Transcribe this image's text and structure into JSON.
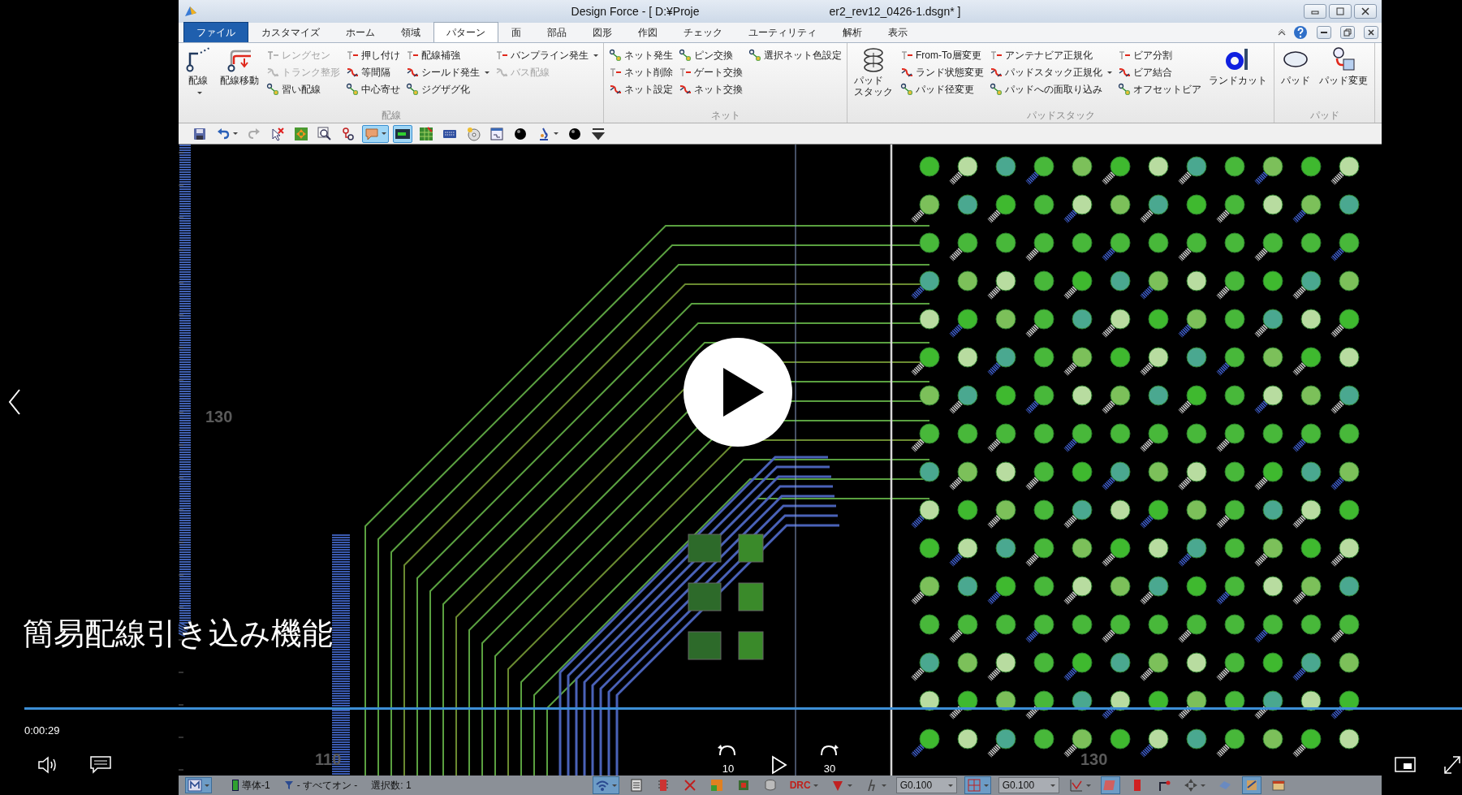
{
  "window": {
    "title_left": "Design Force - [ D:¥Proje",
    "title_right": "er2_rev12_0426-1.dsgn* ]"
  },
  "tabs": [
    {
      "label": "ファイル",
      "kind": "file",
      "selected": false
    },
    {
      "label": "カスタマイズ",
      "kind": "tab",
      "selected": false
    },
    {
      "label": "ホーム",
      "kind": "tab",
      "selected": false
    },
    {
      "label": "領域",
      "kind": "tab",
      "selected": false
    },
    {
      "label": "パターン",
      "kind": "tab",
      "selected": true
    },
    {
      "label": "面",
      "kind": "tab",
      "selected": false
    },
    {
      "label": "部品",
      "kind": "tab",
      "selected": false
    },
    {
      "label": "図形",
      "kind": "tab",
      "selected": false
    },
    {
      "label": "作図",
      "kind": "tab",
      "selected": false
    },
    {
      "label": "チェック",
      "kind": "tab",
      "selected": false
    },
    {
      "label": "ユーティリティ",
      "kind": "tab",
      "selected": false
    },
    {
      "label": "解析",
      "kind": "tab",
      "selected": false
    },
    {
      "label": "表示",
      "kind": "tab",
      "selected": false
    }
  ],
  "ribbon": {
    "groups": [
      {
        "label": "配線",
        "items": [
          {
            "kind": "large",
            "lines": [
              "配線"
            ],
            "dropdown": true
          },
          {
            "kind": "large",
            "lines": [
              "配線移動"
            ],
            "dropdown": false
          },
          {
            "kind": "column",
            "items": [
              {
                "label": "レングセン",
                "disabled": true,
                "dropdown": false
              },
              {
                "label": "トランク整形",
                "disabled": true,
                "dropdown": false
              },
              {
                "label": "習い配線",
                "disabled": false,
                "dropdown": false
              }
            ]
          },
          {
            "kind": "column",
            "items": [
              {
                "label": "押し付け",
                "disabled": false,
                "dropdown": false
              },
              {
                "label": "等間隔",
                "disabled": false,
                "dropdown": false
              },
              {
                "label": "中心寄せ",
                "disabled": false,
                "dropdown": false
              }
            ]
          },
          {
            "kind": "column",
            "items": [
              {
                "label": "配線補強",
                "disabled": false,
                "dropdown": false
              },
              {
                "label": "シールド発生",
                "disabled": false,
                "dropdown": true
              },
              {
                "label": "ジグザグ化",
                "disabled": false,
                "dropdown": false
              }
            ]
          },
          {
            "kind": "column",
            "items": [
              {
                "label": "バンプライン発生",
                "disabled": false,
                "dropdown": true
              },
              {
                "label": "バス配線",
                "disabled": true,
                "dropdown": false
              }
            ]
          }
        ]
      },
      {
        "label": "ネット",
        "items": [
          {
            "kind": "column",
            "items": [
              {
                "label": "ネット発生",
                "disabled": false,
                "dropdown": false
              },
              {
                "label": "ネット削除",
                "disabled": false,
                "dropdown": false
              },
              {
                "label": "ネット設定",
                "disabled": false,
                "dropdown": false
              }
            ]
          },
          {
            "kind": "column",
            "items": [
              {
                "label": "ピン交換",
                "disabled": false,
                "dropdown": false
              },
              {
                "label": "ゲート交換",
                "disabled": false,
                "dropdown": false
              },
              {
                "label": "ネット交換",
                "disabled": false,
                "dropdown": false
              }
            ]
          },
          {
            "kind": "column",
            "items": [
              {
                "label": "選択ネット色設定",
                "disabled": false,
                "dropdown": false
              }
            ]
          }
        ]
      },
      {
        "label": "パッドスタック",
        "items": [
          {
            "kind": "large",
            "lines": [
              "パッド",
              "スタック"
            ],
            "dropdown": false
          },
          {
            "kind": "column",
            "items": [
              {
                "label": "From-To層変更",
                "disabled": false,
                "dropdown": false
              },
              {
                "label": "ランド状態変更",
                "disabled": false,
                "dropdown": false
              },
              {
                "label": "パッド径変更",
                "disabled": false,
                "dropdown": false
              }
            ]
          },
          {
            "kind": "column",
            "items": [
              {
                "label": "アンテナビア正規化",
                "disabled": false,
                "dropdown": false
              },
              {
                "label": "パッドスタック正規化",
                "disabled": false,
                "dropdown": true
              },
              {
                "label": "パッドへの面取り込み",
                "disabled": false,
                "dropdown": false
              }
            ]
          },
          {
            "kind": "column",
            "items": [
              {
                "label": "ビア分割",
                "disabled": false,
                "dropdown": false
              },
              {
                "label": "ビア結合",
                "disabled": false,
                "dropdown": false
              },
              {
                "label": "オフセットビア",
                "disabled": false,
                "dropdown": false
              }
            ]
          },
          {
            "kind": "large",
            "lines": [
              "ランドカット"
            ],
            "dropdown": false
          }
        ]
      },
      {
        "label": "パッド",
        "items": [
          {
            "kind": "large",
            "lines": [
              "パッド"
            ],
            "dropdown": false
          },
          {
            "kind": "large",
            "lines": [
              "パッド変更"
            ],
            "dropdown": false
          }
        ]
      }
    ]
  },
  "quick_toolbar": [
    {
      "on": false,
      "dropdown": false
    },
    {
      "on": false,
      "dropdown": true
    },
    {
      "on": false,
      "dropdown": false
    },
    {
      "on": false,
      "dropdown": false
    },
    {
      "on": false,
      "dropdown": false
    },
    {
      "on": false,
      "dropdown": false
    },
    {
      "on": false,
      "dropdown": false
    },
    {
      "on": true,
      "dropdown": true
    },
    {
      "on": true,
      "dropdown": false
    },
    {
      "on": false,
      "dropdown": false
    },
    {
      "on": false,
      "dropdown": false
    },
    {
      "on": false,
      "dropdown": false
    },
    {
      "on": false,
      "dropdown": false
    },
    {
      "on": false,
      "dropdown": false
    },
    {
      "on": false,
      "dropdown": true
    },
    {
      "on": false,
      "dropdown": false
    },
    {
      "on": false,
      "dropdown": false
    }
  ],
  "canvas": {
    "labels": [
      "130",
      "110",
      "130"
    ]
  },
  "status_bar": [
    {
      "kind": "mode",
      "dropdown": true
    },
    {
      "kind": "layer",
      "label": "導体-1"
    },
    {
      "kind": "filter",
      "label": "- すべてオン -"
    },
    {
      "kind": "text",
      "label": "選択数: 1"
    },
    {
      "kind": "tool",
      "on": true,
      "dropdown": true
    },
    {
      "kind": "tool",
      "on": false,
      "dropdown": false
    },
    {
      "kind": "tool",
      "on": false,
      "dropdown": false
    },
    {
      "kind": "tool",
      "on": false,
      "dropdown": false
    },
    {
      "kind": "tool",
      "on": false,
      "dropdown": false
    },
    {
      "kind": "tool",
      "on": false,
      "dropdown": false
    },
    {
      "kind": "tool",
      "on": false,
      "dropdown": false
    },
    {
      "kind": "label_tool",
      "label": "DRC",
      "dropdown": true
    },
    {
      "kind": "tool",
      "on": false,
      "dropdown": true
    },
    {
      "kind": "tool",
      "on": false,
      "dropdown": true
    },
    {
      "kind": "select",
      "value": "G0.100"
    },
    {
      "kind": "tool",
      "on": true,
      "dropdown": true
    },
    {
      "kind": "select",
      "value": "G0.100"
    },
    {
      "kind": "tool",
      "on": false,
      "dropdown": true
    },
    {
      "kind": "tool",
      "on": true,
      "dropdown": false
    },
    {
      "kind": "tool",
      "on": false,
      "dropdown": false
    },
    {
      "kind": "tool",
      "on": false,
      "dropdown": false
    },
    {
      "kind": "tool",
      "on": false,
      "dropdown": true
    },
    {
      "kind": "tool",
      "on": false,
      "dropdown": false
    },
    {
      "kind": "tool",
      "on": true,
      "dropdown": false
    },
    {
      "kind": "tool",
      "on": false,
      "dropdown": false
    }
  ],
  "player": {
    "subtitle": "簡易配線引き込み機能",
    "time": "0:00:29",
    "skip_back": "10",
    "skip_forward": "30"
  }
}
